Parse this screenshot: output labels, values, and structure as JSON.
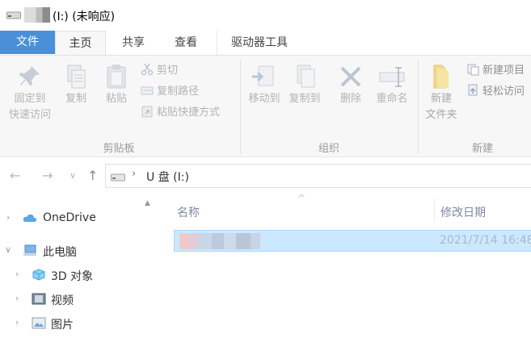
{
  "window": {
    "title": "(I:) (未响应)"
  },
  "ribbon_tabs": [
    {
      "label": "文件"
    },
    {
      "label": "主页"
    },
    {
      "label": "共享"
    },
    {
      "label": "查看"
    },
    {
      "label": "驱动器工具"
    }
  ],
  "clipboard": {
    "pin_line1": "固定到",
    "pin_line2": "快速访问",
    "copy": "复制",
    "paste": "粘贴",
    "cut": "剪切",
    "copy_path": "复制路径",
    "paste_shortcut": "粘贴快捷方式",
    "group_label": "剪贴板"
  },
  "organize": {
    "move_to": "移动到",
    "copy_to": "复制到",
    "delete": "删除",
    "rename": "重命名",
    "group_label": "组织"
  },
  "new": {
    "new_folder_line1": "新建",
    "new_folder_line2": "文件夹",
    "new_item": "新建项目",
    "easy_access": "轻松访问",
    "group_label": "新建"
  },
  "address": {
    "path": "U 盘 (I:)"
  },
  "nav_pane": {
    "items": [
      {
        "label": "OneDrive",
        "icon": "onedrive-cloud-icon"
      },
      {
        "label": "此电脑",
        "icon": "this-pc-icon"
      },
      {
        "label": "3D 对象",
        "icon": "3d-objects-icon"
      },
      {
        "label": "视频",
        "icon": "videos-icon"
      },
      {
        "label": "图片",
        "icon": "pictures-icon"
      }
    ]
  },
  "file_list": {
    "columns": {
      "name": "名称",
      "modified": "修改日期"
    },
    "rows": [
      {
        "modified": "2021/7/14 16:48"
      }
    ]
  },
  "colors": {
    "file_tab": "#4a90d9",
    "selection": "#cce8ff",
    "ribbon_bg": "#f7f7f7"
  }
}
